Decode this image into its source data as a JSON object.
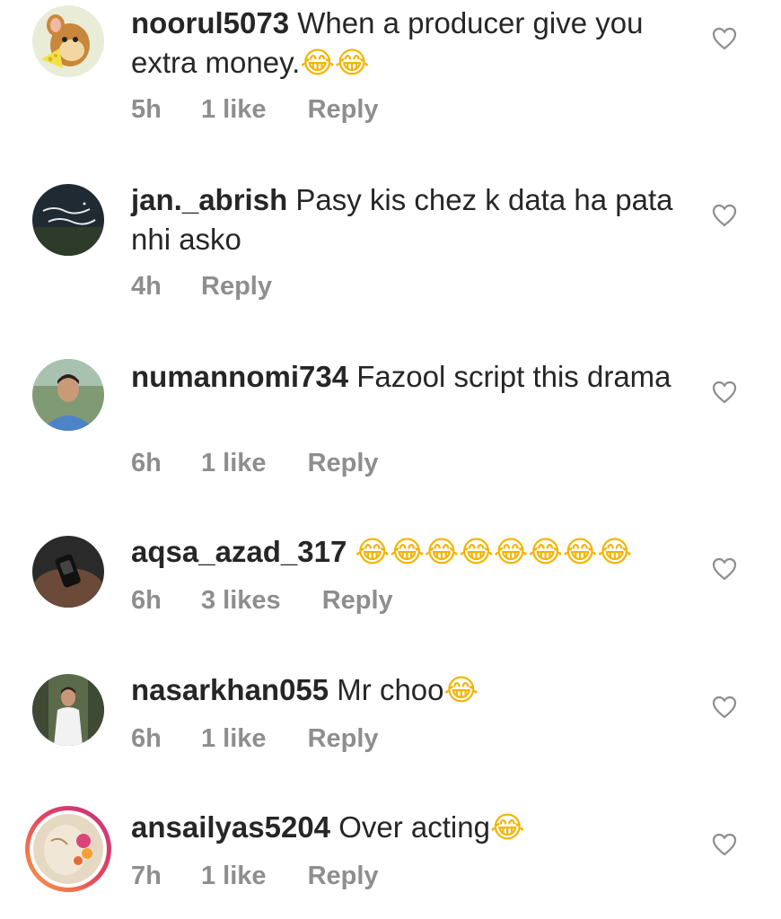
{
  "comments": [
    {
      "username": "noorul5073",
      "text": " When  a producer give you extra money.",
      "emoji": "😂😂",
      "time": "5h",
      "likes": "1 like",
      "reply": "Reply"
    },
    {
      "username": "jan._abrish",
      "text": " Pasy kis chez k data ha pata nhi asko",
      "emoji": "",
      "time": "4h",
      "likes": "",
      "reply": "Reply"
    },
    {
      "username": "numannomi734",
      "text": " Fazool script this drama",
      "emoji": "",
      "time": "6h",
      "likes": "1 like",
      "reply": "Reply"
    },
    {
      "username": "aqsa_azad_317",
      "text": " ",
      "emoji": "😂😂😂😂😂😂😂😂",
      "time": "6h",
      "likes": "3 likes",
      "reply": "Reply"
    },
    {
      "username": "nasarkhan055",
      "text": " Mr choo",
      "emoji": "😂",
      "time": "6h",
      "likes": "1 like",
      "reply": "Reply"
    },
    {
      "username": "ansailyas5204",
      "text": " Over acting",
      "emoji": "😂",
      "time": "7h",
      "likes": "1 like",
      "reply": "Reply"
    }
  ],
  "colors": {
    "text": "#262626",
    "meta": "#8e8e8e",
    "story_ring_start": "#f9a43f",
    "story_ring_end": "#c13584"
  },
  "icons": {
    "like": "heart-outline-icon"
  }
}
